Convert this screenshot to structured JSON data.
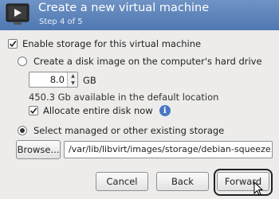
{
  "header": {
    "title": "Create a new virtual machine",
    "step": "Step 4 of 5",
    "icon": "vm-screen-icon"
  },
  "storage": {
    "enable_label": "Enable storage for this virtual machine",
    "enable_checked": true,
    "create_disk_label": "Create a disk image on the computer's hard drive",
    "create_disk_selected": false,
    "size_value": "8.0",
    "size_unit": "GB",
    "available_text": "450.3 Gb available in the default location",
    "allocate_label": "Allocate entire disk now",
    "allocate_checked": true,
    "managed_label": "Select managed or other existing storage",
    "managed_selected": true,
    "browse_label": "Browse...",
    "path_value": "/var/lib/libvirt/images/storage/debian-squeeze.img"
  },
  "buttons": {
    "cancel": "Cancel",
    "back": "Back",
    "forward": "Forward"
  }
}
